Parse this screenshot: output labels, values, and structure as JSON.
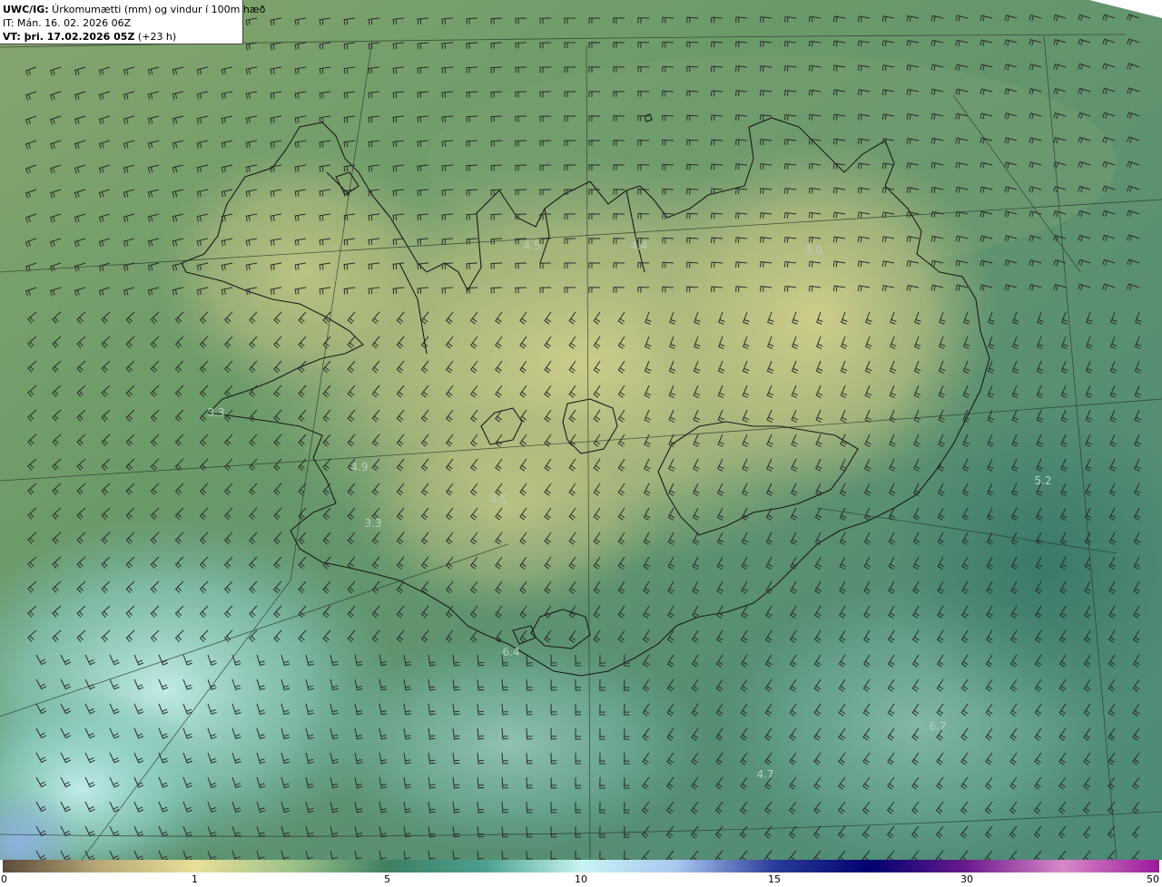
{
  "header": {
    "model": "UWC/IG:",
    "title": " Úrkomumætti (mm) og vindur í 100m hæð",
    "issue_time": "IT: Mán. 16. 02. 2026 06Z",
    "valid_prefix": "VT: þri. 17.02.2026 05Z",
    "valid_suffix": " (+23 h)"
  },
  "colors": {
    "coast": "#1a1a1a",
    "barb": "#2b2b2b",
    "value_label": "#b9cdc0",
    "background_green": "#5f8f66",
    "land_yellow": "#c7c884",
    "sea_teal": "#5e9e94",
    "light_cyan": "#bfeeee",
    "light_blue": "#90b8e0"
  },
  "value_labels": [
    "4.5",
    "4.4",
    "3.0",
    "3.3",
    "4.9",
    "4.5",
    "3.3",
    "6.4",
    "5.2",
    "6.7",
    "4.7"
  ],
  "colorbar": {
    "ticks": [
      "0",
      "1",
      "5",
      "10",
      "15",
      "30",
      "50"
    ],
    "stops": [
      "#5a4a3a",
      "#b8a878",
      "#e8e098",
      "#9dc28a",
      "#3f7f62",
      "#4aa090",
      "#c8f4f2",
      "#a8c8f0",
      "#2a3c98",
      "#000070",
      "#6a1a8c",
      "#d888c8",
      "#9a1a9a"
    ]
  }
}
